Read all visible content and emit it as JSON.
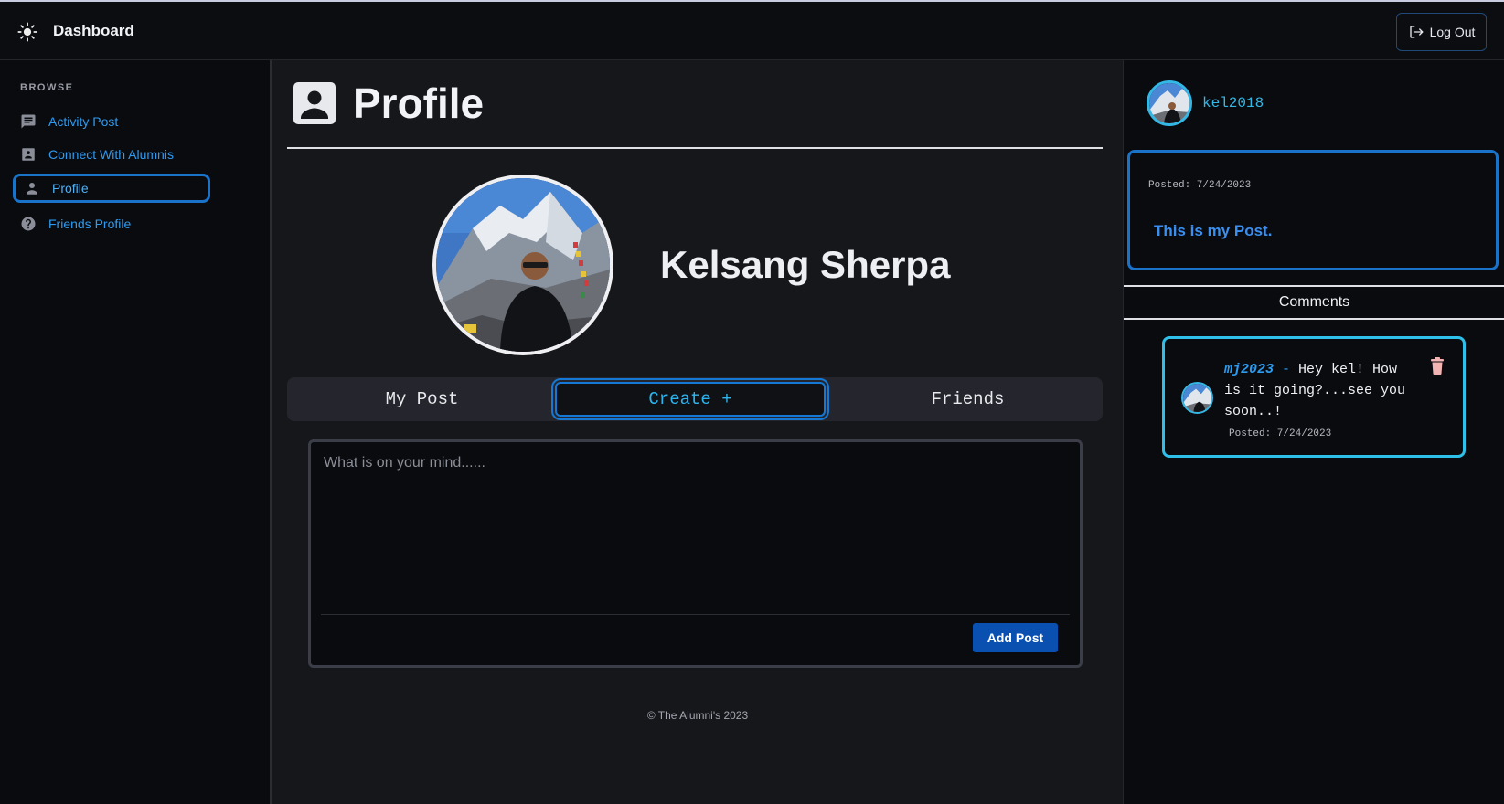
{
  "header": {
    "title": "Dashboard",
    "logout_label": "Log Out"
  },
  "sidebar": {
    "section_label": "BROWSE",
    "items": [
      {
        "label": "Activity Post",
        "icon": "chat-icon"
      },
      {
        "label": "Connect With Alumnis",
        "icon": "contact-card-icon"
      },
      {
        "label": "Profile",
        "icon": "person-icon",
        "active": true
      },
      {
        "label": "Friends Profile",
        "icon": "help-circle-icon"
      }
    ]
  },
  "main": {
    "title": "Profile",
    "profile_name": "Kelsang Sherpa",
    "tabs": [
      {
        "label": "My Post"
      },
      {
        "label": "Create +",
        "active": true
      },
      {
        "label": "Friends"
      }
    ],
    "composer": {
      "placeholder": "What is on your mind......",
      "value": "",
      "submit_label": "Add Post"
    },
    "footer": "© The Alumni's 2023"
  },
  "right_panel": {
    "username": "kel2018",
    "post": {
      "date": "Posted: 7/24/2023",
      "text": "This is my Post."
    },
    "comments_heading": "Comments",
    "comments": [
      {
        "author": "mj2023",
        "separator": " - ",
        "text": "Hey kel! How is it going?...see you soon..!",
        "date": "Posted: 7/24/2023"
      }
    ]
  },
  "colors": {
    "accent": "#1a72c9",
    "link": "#2e9bf0",
    "cyan": "#2ec0e8",
    "button": "#0a50b0",
    "trash": "#f2b3b3"
  }
}
